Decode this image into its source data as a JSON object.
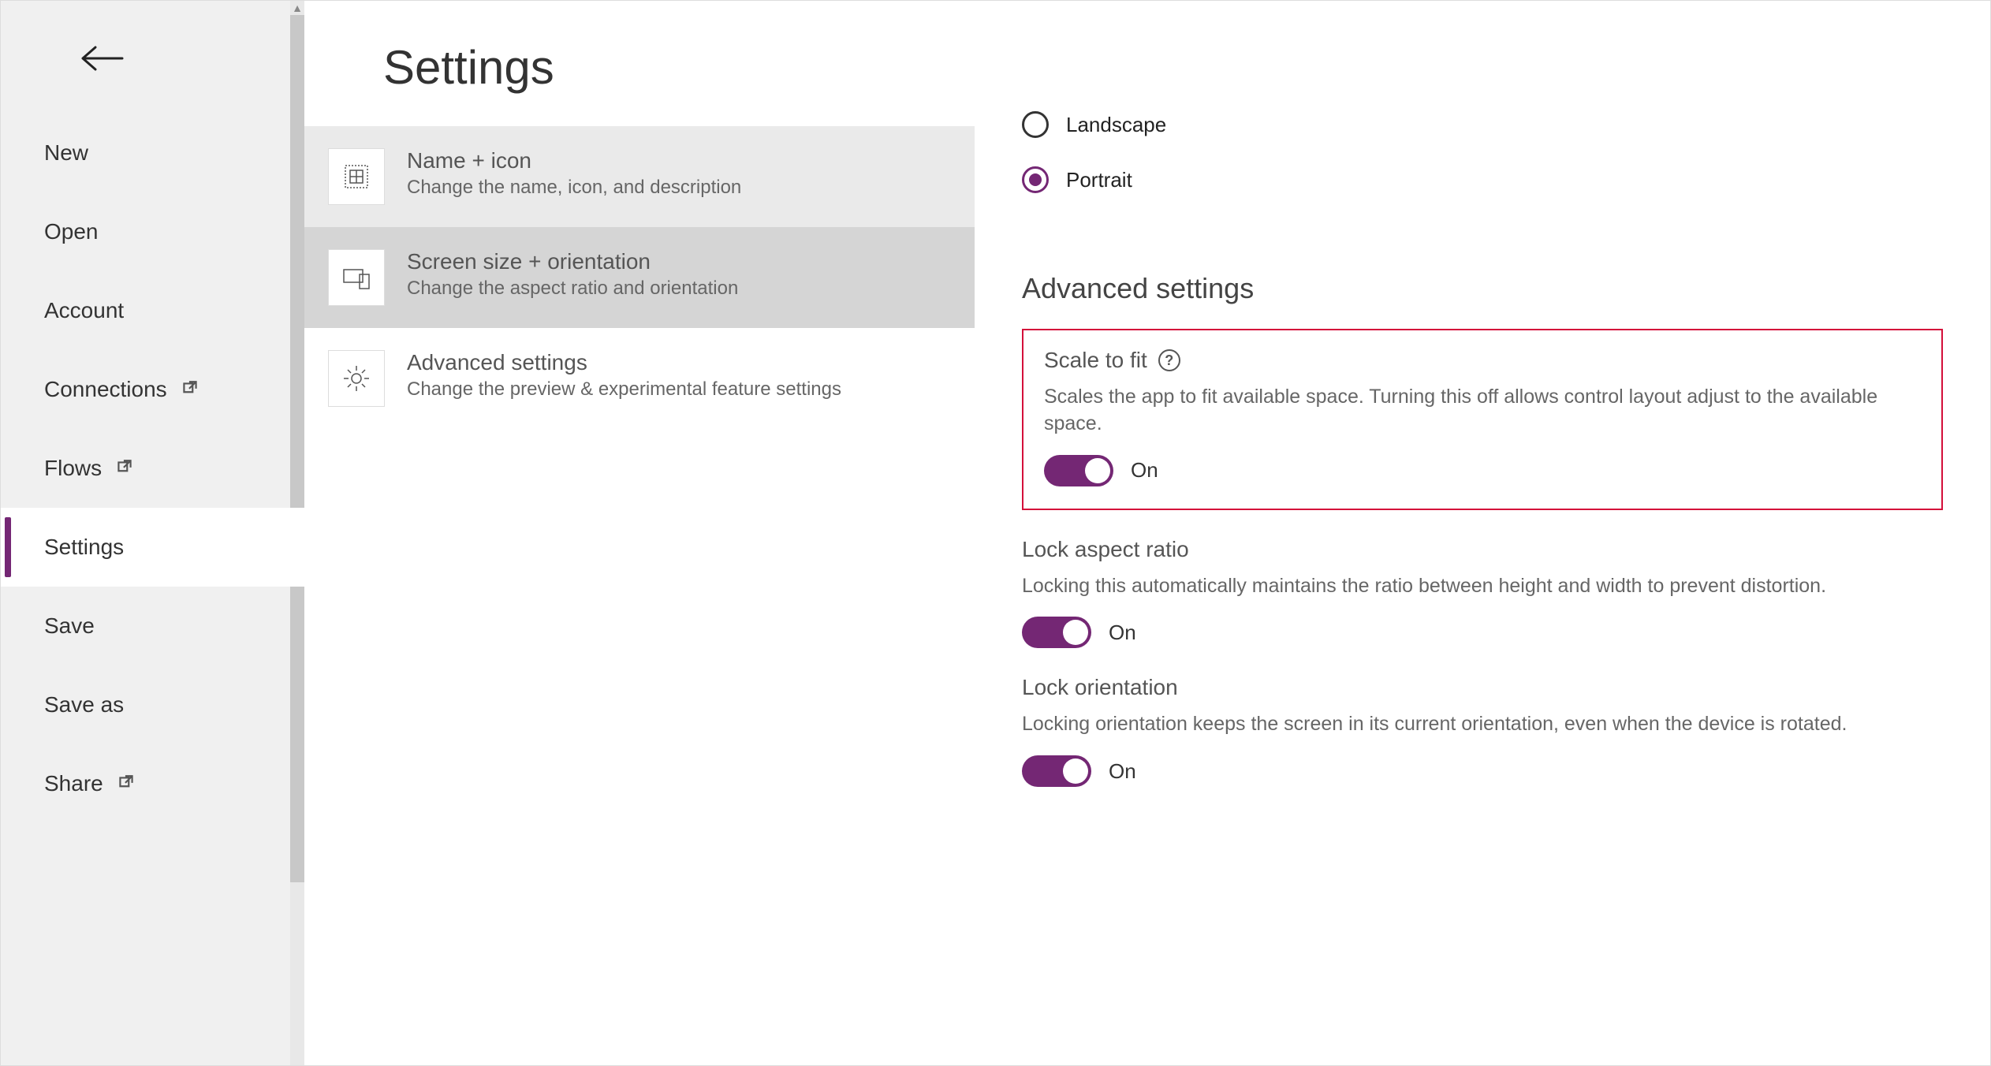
{
  "sidebar": {
    "items": [
      {
        "label": "New"
      },
      {
        "label": "Open"
      },
      {
        "label": "Account"
      },
      {
        "label": "Connections"
      },
      {
        "label": "Flows"
      },
      {
        "label": "Settings"
      },
      {
        "label": "Save"
      },
      {
        "label": "Save as"
      },
      {
        "label": "Share"
      }
    ]
  },
  "page": {
    "title": "Settings"
  },
  "categories": [
    {
      "title": "Name + icon",
      "desc": "Change the name, icon, and description"
    },
    {
      "title": "Screen size + orientation",
      "desc": "Change the aspect ratio and orientation"
    },
    {
      "title": "Advanced settings",
      "desc": "Change the preview & experimental feature settings"
    }
  ],
  "orientation": {
    "options": [
      {
        "label": "Landscape",
        "selected": false
      },
      {
        "label": "Portrait",
        "selected": true
      }
    ]
  },
  "advanced": {
    "heading": "Advanced settings",
    "scale_to_fit": {
      "title": "Scale to fit",
      "desc": "Scales the app to fit available space. Turning this off allows control layout adjust to the available space.",
      "state": "On"
    },
    "lock_aspect": {
      "title": "Lock aspect ratio",
      "desc": "Locking this automatically maintains the ratio between height and width to prevent distortion.",
      "state": "On"
    },
    "lock_orientation": {
      "title": "Lock orientation",
      "desc": "Locking orientation keeps the screen in its current orientation, even when the device is rotated.",
      "state": "On"
    }
  }
}
